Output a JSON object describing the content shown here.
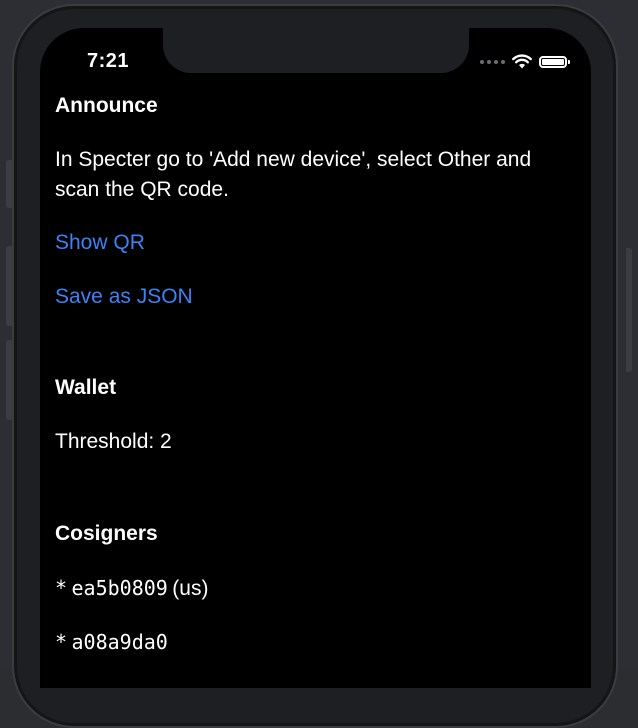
{
  "status_bar": {
    "time": "7:21",
    "icons": [
      "cellular-signal-icon",
      "wifi-icon",
      "battery-icon"
    ]
  },
  "announce": {
    "heading": "Announce",
    "instructions": "In Specter go to 'Add new device', select Other and scan the QR code.",
    "show_qr_label": "Show QR",
    "save_json_label": "Save as JSON"
  },
  "wallet": {
    "heading": "Wallet",
    "threshold_label": "Threshold: 2"
  },
  "cosigners": {
    "heading": "Cosigners",
    "items": [
      {
        "bullet": "*",
        "fingerprint": "ea5b0809",
        "note": "(us)"
      },
      {
        "bullet": "*",
        "fingerprint": "a08a9da0",
        "note": ""
      }
    ]
  },
  "colors": {
    "background": "#000000",
    "text": "#ffffff",
    "link": "#3a82f6"
  }
}
